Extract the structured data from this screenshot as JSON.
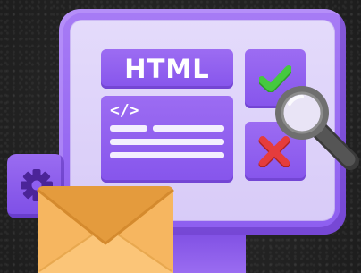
{
  "illustration": {
    "html_label": "HTML",
    "code_tag": "</>",
    "icons": [
      "code-icon",
      "check-icon",
      "cross-icon",
      "magnifier-icon",
      "gear-icon",
      "envelope-icon"
    ],
    "colors": {
      "background": "#242424",
      "purple": "#8d5ef0",
      "screen": "#e0d5fa",
      "check": "#3fbf3b",
      "cross": "#e23b3b",
      "envelope": "#f4b25a",
      "magnifier": "#6a6a6a"
    }
  }
}
